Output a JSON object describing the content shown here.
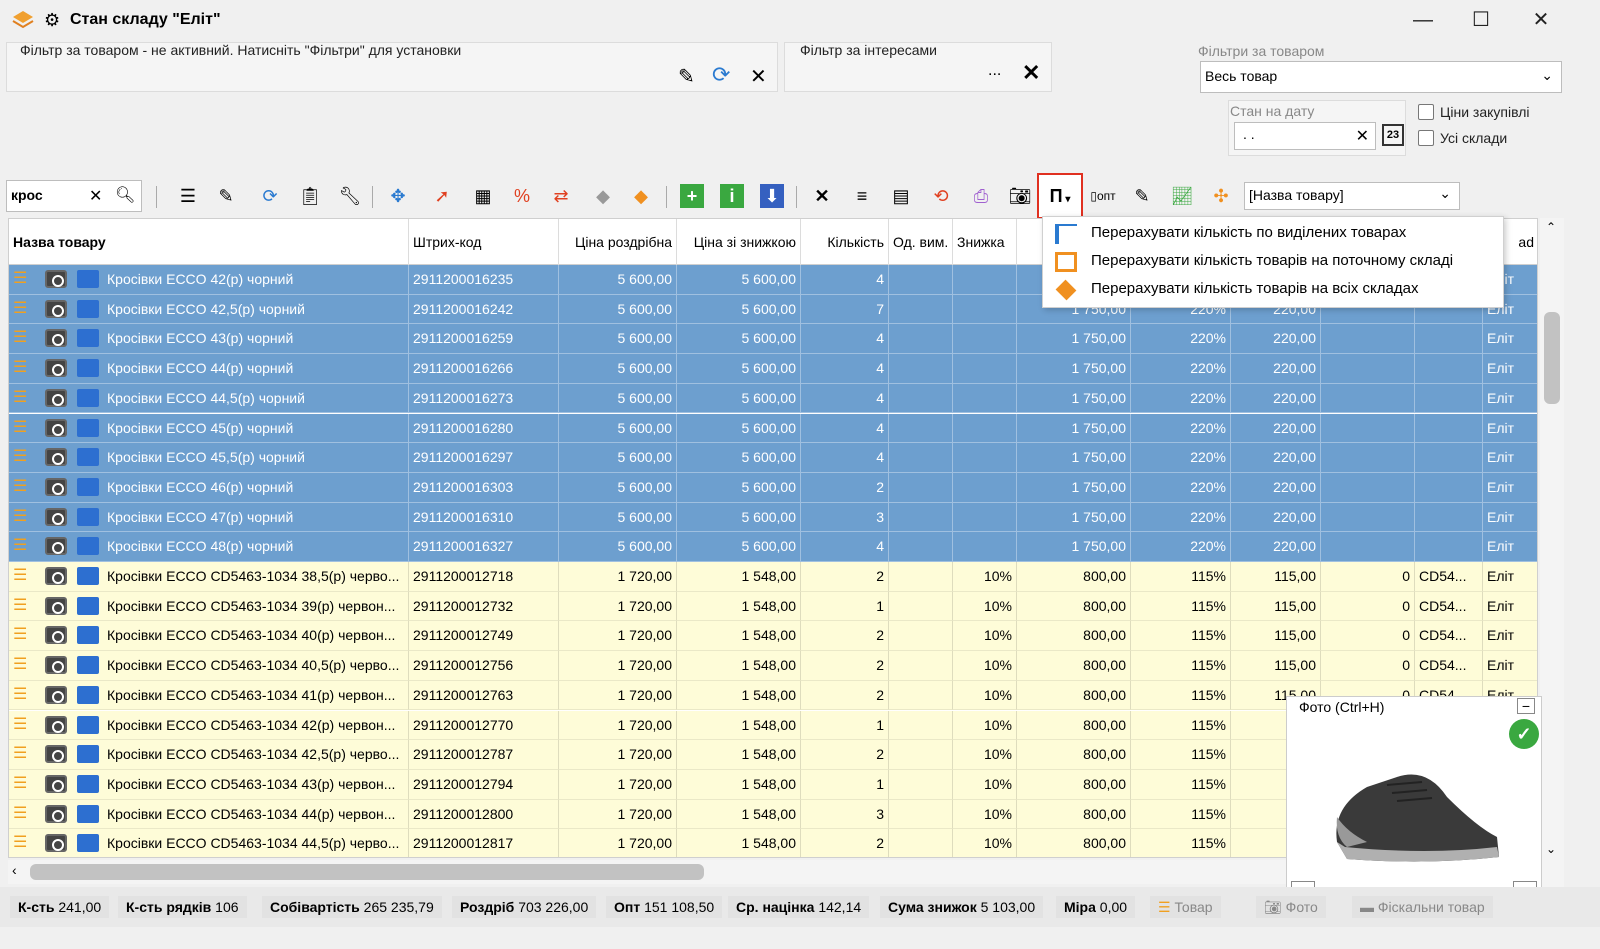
{
  "window": {
    "title": "Стан складу \"Еліт\"",
    "min": "—",
    "max": "☐",
    "close": "✕"
  },
  "filter_product": {
    "label": "Фільтр за товаром - не активний. Натисніть \"Фільтри\" для установки"
  },
  "filter_interest": {
    "label": "Фільтр за інтересами",
    "more": "...",
    "clear": "✕"
  },
  "filters_by_product": {
    "label": "Фільтри за товаром",
    "value": "Весь товар"
  },
  "state_date": {
    "label": "Стан на дату",
    "value": ". .",
    "calendar_day": "23"
  },
  "checkboxes": {
    "purchase_prices": "Ціни закупівлі",
    "all_warehouses": "Усі склади"
  },
  "search": {
    "value": "крос"
  },
  "sort_field": {
    "value": "[Назва товару]"
  },
  "recalc_button": {
    "label": "П"
  },
  "menu": {
    "items": [
      "Перерахувати кількість по виділених товарах",
      "Перерахувати кількість товарів на поточному складі",
      "Перерахувати кількість товарів на всіх складах"
    ]
  },
  "columns": {
    "name": "Назва товару",
    "barcode": "Штрих-код",
    "retail": "Ціна роздрібна",
    "discount_price": "Ціна зі знижкою",
    "qty": "Кількість",
    "unit": "Од. вим.",
    "discount": "Знижка",
    "last": "ad"
  },
  "rows": [
    {
      "name": "Кросівки ECCO 42(р) чорний",
      "barcode": "2911200016235",
      "retail": "5 600,00",
      "dprice": "5 600,00",
      "qty": "4",
      "unit": "",
      "disc": "",
      "cost": "",
      "markup": "",
      "opt": "",
      "c11": "",
      "c12": "",
      "wh": "Еліт",
      "sel": true
    },
    {
      "name": "Кросівки ECCO 42,5(р) чорний",
      "barcode": "2911200016242",
      "retail": "5 600,00",
      "dprice": "5 600,00",
      "qty": "7",
      "unit": "",
      "disc": "",
      "cost": "1 750,00",
      "markup": "220%",
      "opt": "220,00",
      "c11": "",
      "c12": "",
      "wh": "Еліт",
      "sel": true
    },
    {
      "name": "Кросівки ECCO 43(р) чорний",
      "barcode": "2911200016259",
      "retail": "5 600,00",
      "dprice": "5 600,00",
      "qty": "4",
      "unit": "",
      "disc": "",
      "cost": "1 750,00",
      "markup": "220%",
      "opt": "220,00",
      "c11": "",
      "c12": "",
      "wh": "Еліт",
      "sel": true
    },
    {
      "name": "Кросівки ECCO 44(р) чорний",
      "barcode": "2911200016266",
      "retail": "5 600,00",
      "dprice": "5 600,00",
      "qty": "4",
      "unit": "",
      "disc": "",
      "cost": "1 750,00",
      "markup": "220%",
      "opt": "220,00",
      "c11": "",
      "c12": "",
      "wh": "Еліт",
      "sel": true
    },
    {
      "name": "Кросівки ECCO 44,5(р) чорний",
      "barcode": "2911200016273",
      "retail": "5 600,00",
      "dprice": "5 600,00",
      "qty": "4",
      "unit": "",
      "disc": "",
      "cost": "1 750,00",
      "markup": "220%",
      "opt": "220,00",
      "c11": "",
      "c12": "",
      "wh": "Еліт",
      "sel": true
    },
    {
      "name": "Кросівки ECCO 45(р) чорний",
      "barcode": "2911200016280",
      "retail": "5 600,00",
      "dprice": "5 600,00",
      "qty": "4",
      "unit": "",
      "disc": "",
      "cost": "1 750,00",
      "markup": "220%",
      "opt": "220,00",
      "c11": "",
      "c12": "",
      "wh": "Еліт",
      "sel": true
    },
    {
      "name": "Кросівки ECCO 45,5(р) чорний",
      "barcode": "2911200016297",
      "retail": "5 600,00",
      "dprice": "5 600,00",
      "qty": "4",
      "unit": "",
      "disc": "",
      "cost": "1 750,00",
      "markup": "220%",
      "opt": "220,00",
      "c11": "",
      "c12": "",
      "wh": "Еліт",
      "sel": true
    },
    {
      "name": "Кросівки ECCO 46(р) чорний",
      "barcode": "2911200016303",
      "retail": "5 600,00",
      "dprice": "5 600,00",
      "qty": "2",
      "unit": "",
      "disc": "",
      "cost": "1 750,00",
      "markup": "220%",
      "opt": "220,00",
      "c11": "",
      "c12": "",
      "wh": "Еліт",
      "sel": true
    },
    {
      "name": "Кросівки ECCO 47(р) чорний",
      "barcode": "2911200016310",
      "retail": "5 600,00",
      "dprice": "5 600,00",
      "qty": "3",
      "unit": "",
      "disc": "",
      "cost": "1 750,00",
      "markup": "220%",
      "opt": "220,00",
      "c11": "",
      "c12": "",
      "wh": "Еліт",
      "sel": true
    },
    {
      "name": "Кросівки ECCO 48(р) чорний",
      "barcode": "2911200016327",
      "retail": "5 600,00",
      "dprice": "5 600,00",
      "qty": "4",
      "unit": "",
      "disc": "",
      "cost": "1 750,00",
      "markup": "220%",
      "opt": "220,00",
      "c11": "",
      "c12": "",
      "wh": "Еліт",
      "sel": true
    },
    {
      "name": "Кросівки ECCO CD5463-1034 38,5(р) черво...",
      "barcode": "2911200012718",
      "retail": "1 720,00",
      "dprice": "1 548,00",
      "qty": "2",
      "unit": "",
      "disc": "10%",
      "cost": "800,00",
      "markup": "115%",
      "opt": "115,00",
      "c11": "0",
      "c12": "CD54...",
      "wh": "Еліт",
      "sel": false
    },
    {
      "name": "Кросівки ECCO CD5463-1034 39(р) червон...",
      "barcode": "2911200012732",
      "retail": "1 720,00",
      "dprice": "1 548,00",
      "qty": "1",
      "unit": "",
      "disc": "10%",
      "cost": "800,00",
      "markup": "115%",
      "opt": "115,00",
      "c11": "0",
      "c12": "CD54...",
      "wh": "Еліт",
      "sel": false
    },
    {
      "name": "Кросівки ECCO CD5463-1034 40(р) червон...",
      "barcode": "2911200012749",
      "retail": "1 720,00",
      "dprice": "1 548,00",
      "qty": "2",
      "unit": "",
      "disc": "10%",
      "cost": "800,00",
      "markup": "115%",
      "opt": "115,00",
      "c11": "0",
      "c12": "CD54...",
      "wh": "Еліт",
      "sel": false
    },
    {
      "name": "Кросівки ECCO CD5463-1034 40,5(р) черво...",
      "barcode": "2911200012756",
      "retail": "1 720,00",
      "dprice": "1 548,00",
      "qty": "2",
      "unit": "",
      "disc": "10%",
      "cost": "800,00",
      "markup": "115%",
      "opt": "115,00",
      "c11": "0",
      "c12": "CD54...",
      "wh": "Еліт",
      "sel": false
    },
    {
      "name": "Кросівки ECCO CD5463-1034 41(р) червон...",
      "barcode": "2911200012763",
      "retail": "1 720,00",
      "dprice": "1 548,00",
      "qty": "2",
      "unit": "",
      "disc": "10%",
      "cost": "800,00",
      "markup": "115%",
      "opt": "115,00",
      "c11": "0",
      "c12": "CD54",
      "wh": "Еліт",
      "sel": false
    },
    {
      "name": "Кросівки ECCO CD5463-1034 42(р) червон...",
      "barcode": "2911200012770",
      "retail": "1 720,00",
      "dprice": "1 548,00",
      "qty": "1",
      "unit": "",
      "disc": "10%",
      "cost": "800,00",
      "markup": "115%",
      "opt": "11",
      "c11": "",
      "c12": "",
      "wh": "",
      "sel": false
    },
    {
      "name": "Кросівки ECCO CD5463-1034 42,5(р) черво...",
      "barcode": "2911200012787",
      "retail": "1 720,00",
      "dprice": "1 548,00",
      "qty": "2",
      "unit": "",
      "disc": "10%",
      "cost": "800,00",
      "markup": "115%",
      "opt": "11",
      "c11": "",
      "c12": "",
      "wh": "",
      "sel": false
    },
    {
      "name": "Кросівки ECCO CD5463-1034 43(р) червон...",
      "barcode": "2911200012794",
      "retail": "1 720,00",
      "dprice": "1 548,00",
      "qty": "1",
      "unit": "",
      "disc": "10%",
      "cost": "800,00",
      "markup": "115%",
      "opt": "11",
      "c11": "",
      "c12": "",
      "wh": "",
      "sel": false
    },
    {
      "name": "Кросівки ECCO CD5463-1034 44(р) червон...",
      "barcode": "2911200012800",
      "retail": "1 720,00",
      "dprice": "1 548,00",
      "qty": "3",
      "unit": "",
      "disc": "10%",
      "cost": "800,00",
      "markup": "115%",
      "opt": "11",
      "c11": "",
      "c12": "",
      "wh": "",
      "sel": false
    },
    {
      "name": "Кросівки ECCO CD5463-1034 44,5(р) черво...",
      "barcode": "2911200012817",
      "retail": "1 720,00",
      "dprice": "1 548,00",
      "qty": "2",
      "unit": "",
      "disc": "10%",
      "cost": "800,00",
      "markup": "115%",
      "opt": "11",
      "c11": "",
      "c12": "",
      "wh": "",
      "sel": false
    }
  ],
  "photo": {
    "title": "Фото (Ctrl+H)",
    "collapse": "−",
    "prev": "‹",
    "next": "›"
  },
  "status": {
    "qty_label": "К-сть",
    "qty": "241,00",
    "rows_label": "К-сть рядків",
    "rows": "106",
    "cost_label": "Собівартість",
    "cost": "265 235,79",
    "retail_label": "Роздріб",
    "retail": "703 226,00",
    "opt_label": "Опт",
    "opt": "151 108,50",
    "avg_label": "Ср. націнка",
    "avg": "142,14",
    "disc_label": "Сума знижок",
    "disc": "5 103,00",
    "measure_label": "Міра",
    "measure": "0,00",
    "tab_product": "Товар",
    "tab_photo": "Фото",
    "tab_fiscal": "Фіскальни товар"
  },
  "colors": {
    "selected_row": "#6d9fcf",
    "yellow_row": "#fefcd8",
    "menu_highlight_border": "#e03020"
  }
}
